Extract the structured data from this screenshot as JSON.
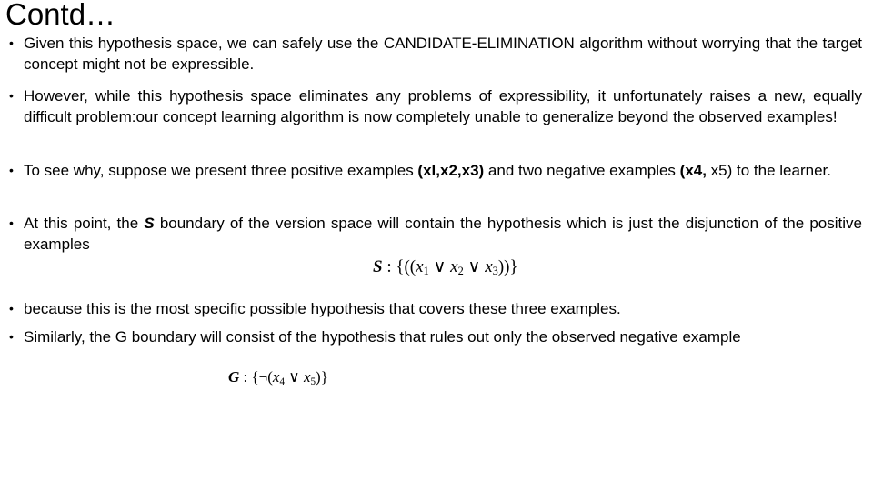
{
  "slide": {
    "title": "Contd…",
    "bullets": [
      {
        "text": "Given this hypothesis space, we can safely use the CANDIDATE-ELIMINATION algorithm without worrying that the target concept might not be expressible."
      },
      {
        "text": "However, while this hypothesis space eliminates any problems of expressibility, it unfortunately raises a new, equally difficult problem:our concept learning algorithm is now completely unable to generalize beyond the observed examples!"
      },
      {
        "parts": {
          "a": "To see why, suppose we present three positive examples ",
          "b_bold": "(xl,x2,x3)",
          "c": " and two negative examples ",
          "d_bold": "(x4,",
          "e": " x5) to the learner."
        }
      },
      {
        "parts": {
          "a": "At this point, the ",
          "b_bold_italic": "S",
          "c": " boundary of the version space will contain the hypothesis which is just the disjunction of the positive examples"
        }
      },
      {
        "text": "because this is the most specific possible hypothesis that covers these three examples."
      },
      {
        "text": "Similarly, the G boundary will consist of the hypothesis that rules out only the observed negative example"
      }
    ],
    "bullet_glyph": "•",
    "formula_s": {
      "symbol": "S",
      "sep": " : {((",
      "x1": "x",
      "x1_sub": "1",
      "or1": " ∨ ",
      "x2": "x",
      "x2_sub": "2",
      "or2": " ∨ ",
      "x3": "x",
      "x3_sub": "3",
      "close": "))}"
    },
    "formula_g": {
      "symbol": "G",
      "sep": " : {¬(",
      "x4": "x",
      "x4_sub": "4",
      "or": " ∨ ",
      "x5": "x",
      "x5_sub": "5",
      "close": ")}"
    }
  }
}
